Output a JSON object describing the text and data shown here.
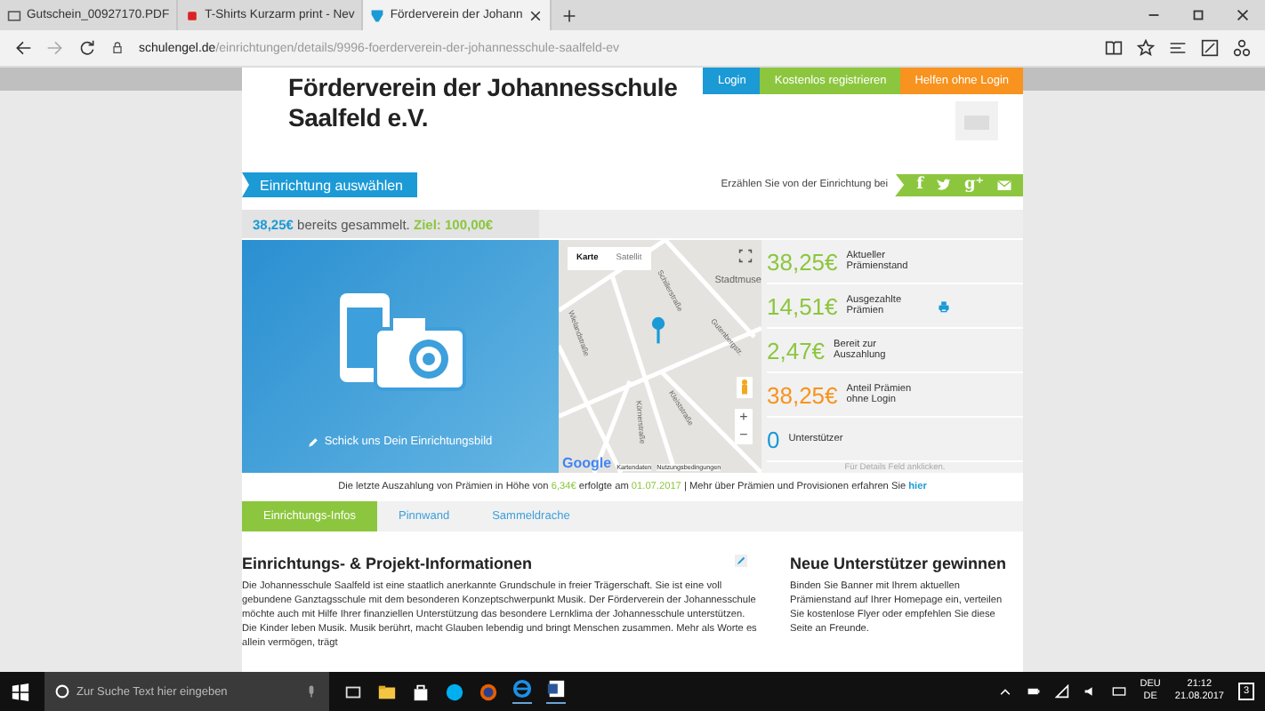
{
  "browser": {
    "tabs": [
      {
        "title": "Gutschein_00927170.PDF",
        "kind": "doc",
        "selected": false
      },
      {
        "title": "T-Shirts Kurzarm print - Nev",
        "kind": "shop",
        "selected": false
      },
      {
        "title": "Förderverein der Johann",
        "kind": "site",
        "selected": true
      }
    ],
    "url_host": "schulengel.de",
    "url_path": "/einrichtungen/details/9996-foerderverein-der-johannesschule-saalfeld-ev"
  },
  "top_buttons": [
    {
      "label": "Login",
      "color": "#1b9ad6"
    },
    {
      "label": "Kostenlos registrieren",
      "color": "#8cc63e"
    },
    {
      "label": "Helfen ohne Login",
      "color": "#f7931e"
    }
  ],
  "title": "Förderverein der Johannesschule Saalfeld e.V.",
  "select_button": "Einrichtung auswählen",
  "share": {
    "label": "Erzählen Sie von der Einrichtung bei",
    "services": [
      {
        "kind": "facebook",
        "glyph": "f"
      },
      {
        "kind": "twitter"
      },
      {
        "kind": "googleplus",
        "glyph": "g⁺"
      },
      {
        "kind": "mail"
      }
    ]
  },
  "progress": {
    "collected": "38,25€",
    "text": "bereits gesammelt.",
    "goal": "Ziel: 100,00€",
    "level": 0.38
  },
  "photo_caption": "Schick uns Dein Einrichtungsbild",
  "map": {
    "types": [
      {
        "label": "Karte",
        "selected": true
      },
      {
        "label": "Satellit",
        "selected": false
      }
    ],
    "streets": [
      "Stadtmuse",
      "Schillerstraße",
      "Wielandstraße",
      "Gutenbergstr.",
      "Kleiststraße",
      "Körnerstraße"
    ],
    "zoom": [
      "+",
      "−"
    ],
    "logo": "Google",
    "attribution": [
      "Kartendaten",
      "Nutzungsbedingungen"
    ]
  },
  "stats": [
    {
      "amount": "38,25€",
      "label": "Aktueller Prämienstand",
      "color": "#8cc63e",
      "kind": "plain"
    },
    {
      "amount": "14,51€",
      "label": "Ausgezahlte Prämien",
      "color": "#8cc63e",
      "kind": "print"
    },
    {
      "amount": "2,47€",
      "label": "Bereit zur Auszahlung",
      "color": "#8cc63e",
      "kind": "plain"
    },
    {
      "amount": "38,25€",
      "label": "Anteil Prämien ohne Login",
      "color": "#f7931e",
      "kind": "plain"
    },
    {
      "amount": "0",
      "label": "Unterstützer",
      "color": "#1b9ad6",
      "kind": "plain"
    }
  ],
  "stats_hint": "Für Details Feld anklicken.",
  "payout": {
    "before": "Die letzte Auszahlung von Prämien in Höhe von",
    "amount": "6,34€",
    "middle": "erfolgte am",
    "date": "01.07.2017",
    "after": "| Mehr über Prämien und Provisionen erfahren Sie",
    "link": "hier"
  },
  "content_tabs": [
    {
      "label": "Einrichtungs-Infos",
      "selected": true
    },
    {
      "label": "Pinnwand",
      "selected": false
    },
    {
      "label": "Sammeldrache",
      "selected": false
    }
  ],
  "info": {
    "heading": "Einrichtungs- & Projekt-Informationen",
    "text": "Die Johannesschule Saalfeld ist eine staatlich anerkannte Grundschule in freier Trägerschaft. Sie ist eine voll gebundene Ganztagsschule mit dem besonderen Konzeptschwerpunkt Musik. Der Förderverein der Johannesschule möchte auch mit Hilfe Ihrer finanziellen Unterstützung das besondere Lernklima der Johannesschule unterstützen. Die Kinder leben Musik. Musik berührt, macht Glauben lebendig und bringt Menschen zusammen. Mehr als Worte es allein vermögen, trägt"
  },
  "sidebar": {
    "heading": "Neue Unterstützer gewinnen",
    "text": "Binden Sie Banner mit Ihrem aktuellen Prämienstand auf Ihrer Homepage ein, verteilen Sie kostenlose Flyer oder empfehlen Sie diese Seite an Freunde."
  },
  "taskbar": {
    "search_placeholder": "Zur Suche Text hier eingeben",
    "language": "DEU",
    "layout": "DE",
    "time": "21:12",
    "date": "21.08.2017",
    "notifications": "3"
  }
}
